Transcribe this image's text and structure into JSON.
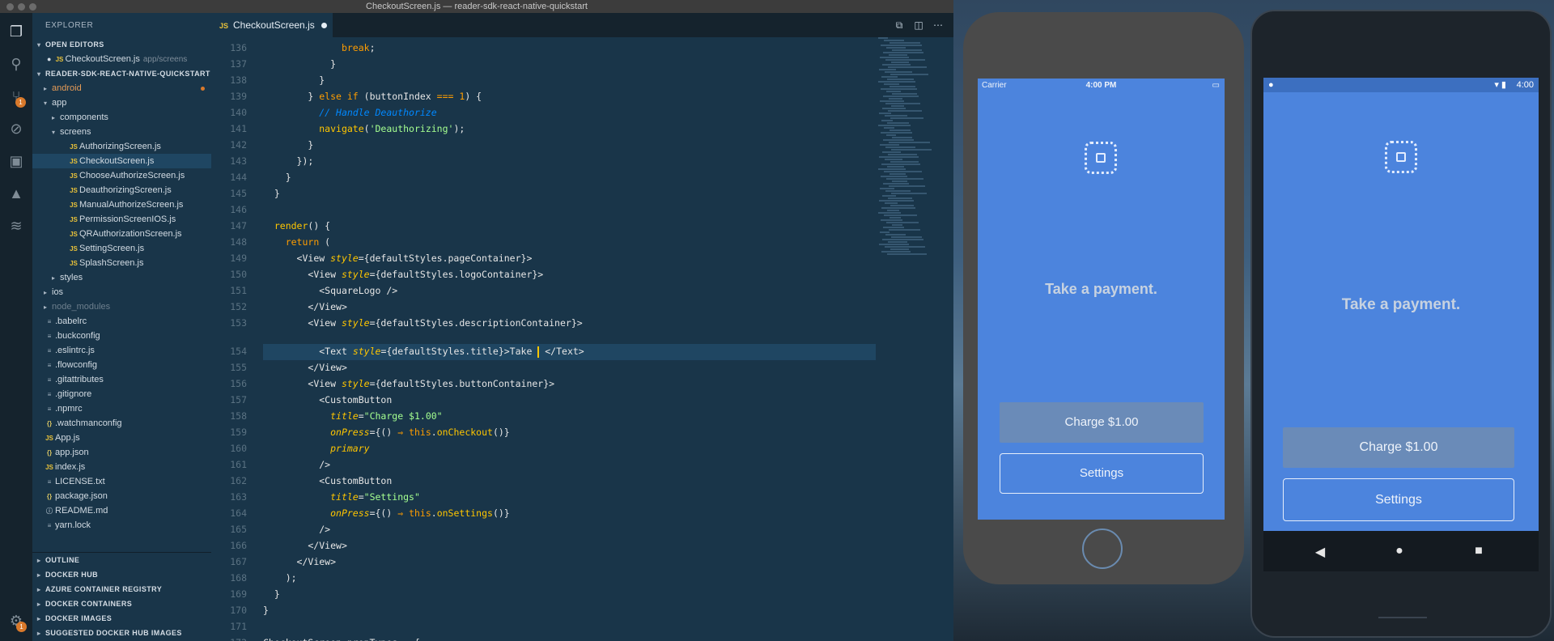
{
  "window": {
    "title": "CheckoutScreen.js — reader-sdk-react-native-quickstart"
  },
  "activity_badges": {
    "scm": "1",
    "settings": "1"
  },
  "sidebar": {
    "title": "EXPLORER",
    "open_editors": "OPEN EDITORS",
    "open_file": {
      "name": "CheckoutScreen.js",
      "path": "app/screens"
    },
    "project": "READER-SDK-REACT-NATIVE-QUICKSTART",
    "tree": {
      "android": "android",
      "app": "app",
      "components": "components",
      "screens": "screens",
      "files": [
        "AuthorizingScreen.js",
        "CheckoutScreen.js",
        "ChooseAuthorizeScreen.js",
        "DeauthorizingScreen.js",
        "ManualAuthorizeScreen.js",
        "PermissionScreenIOS.js",
        "QRAuthorizationScreen.js",
        "SettingScreen.js",
        "SplashScreen.js"
      ],
      "styles": "styles",
      "ios": "ios",
      "node_modules": "node_modules",
      "root_files": [
        ".babelrc",
        ".buckconfig",
        ".eslintrc.js",
        ".flowconfig",
        ".gitattributes",
        ".gitignore",
        ".npmrc",
        ".watchmanconfig",
        "App.js",
        "app.json",
        "index.js",
        "LICENSE.txt",
        "package.json",
        "README.md",
        "yarn.lock"
      ]
    },
    "panels": [
      "OUTLINE",
      "DOCKER HUB",
      "AZURE CONTAINER REGISTRY",
      "DOCKER CONTAINERS",
      "DOCKER IMAGES",
      "SUGGESTED DOCKER HUB IMAGES"
    ]
  },
  "editor": {
    "tab_label": "CheckoutScreen.js",
    "line_numbers": [
      "136",
      "137",
      "138",
      "139",
      "140",
      "141",
      "142",
      "143",
      "144",
      "145",
      "146",
      "147",
      "148",
      "149",
      "150",
      "151",
      "152",
      "153",
      "154",
      "155",
      "156",
      "157",
      "158",
      "159",
      "160",
      "161",
      "162",
      "163",
      "164",
      "165",
      "166",
      "167",
      "168",
      "169",
      "170",
      "171",
      "172"
    ]
  },
  "iphone": {
    "carrier": "Carrier",
    "time": "4:00 PM",
    "title": "Take a payment.",
    "charge": "Charge $1.00",
    "settings": "Settings"
  },
  "android": {
    "time": "4:00",
    "title": "Take a payment.",
    "charge": "Charge $1.00",
    "settings": "Settings"
  }
}
